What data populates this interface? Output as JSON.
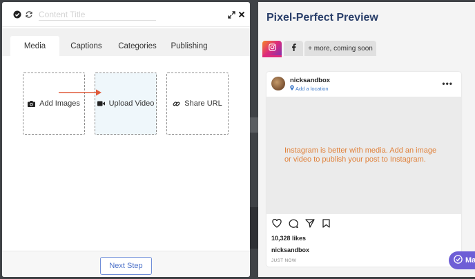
{
  "editor": {
    "title_placeholder": "Content Title",
    "tabs": [
      {
        "label": "Media",
        "active": true
      },
      {
        "label": "Captions",
        "active": false
      },
      {
        "label": "Categories",
        "active": false
      },
      {
        "label": "Publishing",
        "active": false
      }
    ],
    "media_options": [
      {
        "label": "Add Images",
        "icon": "camera-icon"
      },
      {
        "label": "Upload Video",
        "icon": "video-icon"
      },
      {
        "label": "Share URL",
        "icon": "link-icon"
      }
    ],
    "next_button": "Next Step",
    "arrow_color": "#e05a3a"
  },
  "preview": {
    "title": "Pixel-Perfect Preview",
    "tabs": [
      {
        "icon": "instagram-icon",
        "active": true
      },
      {
        "icon": "facebook-icon",
        "active": false
      },
      {
        "label": "+ more, coming soon"
      }
    ],
    "post": {
      "username": "nicksandbox",
      "location": "Add a location",
      "media_message": "Instagram is better with media. Add an image or video to publish your post to Instagram.",
      "likes": "10,328 likes",
      "caption_user": "nicksandbox",
      "timestamp": "JUST NOW"
    }
  },
  "fab": {
    "label": "Ma"
  },
  "colors": {
    "accent_blue": "#4d72c9",
    "preview_title": "#2a3f6a",
    "media_message": "#e0813a",
    "fab": "#6e5ed6"
  }
}
